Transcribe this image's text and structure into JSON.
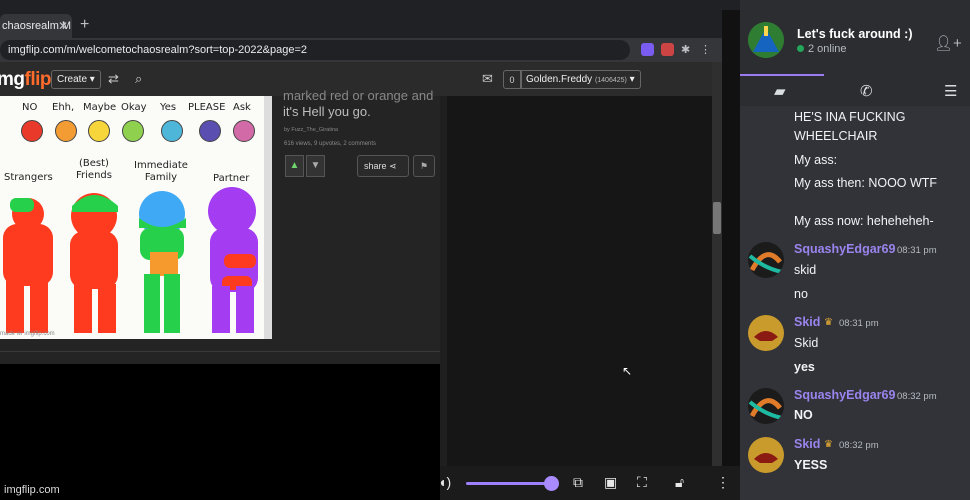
{
  "browser": {
    "top_url": "https://myproxy.com/app/room/s0f3yRFI2L0VGOSwK4ejg",
    "tab_title": "chaosrealm M",
    "new_tab_label": "+",
    "address": "imgflip.com/m/welcometochaosrealm?sort=top-2022&page=2"
  },
  "imgflip": {
    "logo_prefix": "mg",
    "logo_suffix": "flip",
    "create_label": "Create ▾",
    "notif_count": "0",
    "username": "Golden.Freddy",
    "user_points": "(1406425)",
    "caption_line1": "marked red or orange and",
    "caption_line2": "it's Hell you go.",
    "by_line": "by Fuzz_The_Giratina",
    "stats": "616 views, 9 upvotes, 2 comments",
    "share_label": "share",
    "site_watermark": "imgflip.com",
    "meme_watermark": "made w/ imgflip.com",
    "meme": {
      "top_labels": [
        "NO",
        "Ehh,",
        "Maybe",
        "Okay",
        "Yes",
        "PLEASE",
        "Ask"
      ],
      "dot_colors": [
        "#e8392b",
        "#f39c34",
        "#f7d63b",
        "#8fd14f",
        "#4db6d9",
        "#5a4fb0",
        "#d26aa8"
      ],
      "categories": [
        "Strangers",
        "(Best)\nFriends",
        "Immediate\nFamily",
        "Partner"
      ]
    }
  },
  "discord": {
    "dm_name": "Let's fuck around :)",
    "online_text": "2 online",
    "messages": [
      {
        "type": "continuation",
        "text": "HE'S INA FUCKING"
      },
      {
        "type": "continuation",
        "text": "WHEELCHAIR"
      },
      {
        "type": "continuation",
        "text": "My ass:"
      },
      {
        "type": "continuation",
        "text": "My ass then: NOOO WTF"
      },
      {
        "type": "continuation",
        "text": "My ass now: heheheheh-"
      },
      {
        "type": "author",
        "user": "SquashyEdgar69",
        "time": "08:31 pm",
        "color": "#9b84ee"
      },
      {
        "type": "line",
        "text": "skid"
      },
      {
        "type": "line",
        "text": "no"
      },
      {
        "type": "author",
        "user": "Skid",
        "time": "08:31 pm",
        "color": "#9b84ee",
        "crown": true
      },
      {
        "type": "line",
        "text": "Skid"
      },
      {
        "type": "line",
        "text": "yes"
      },
      {
        "type": "author",
        "user": "SquashyEdgar69",
        "time": "08:32 pm",
        "color": "#9b84ee"
      },
      {
        "type": "line",
        "text": "NO"
      },
      {
        "type": "author",
        "user": "Skid",
        "time": "08:32 pm",
        "color": "#9b84ee",
        "crown": true
      },
      {
        "type": "line",
        "text": "YESS"
      }
    ]
  }
}
